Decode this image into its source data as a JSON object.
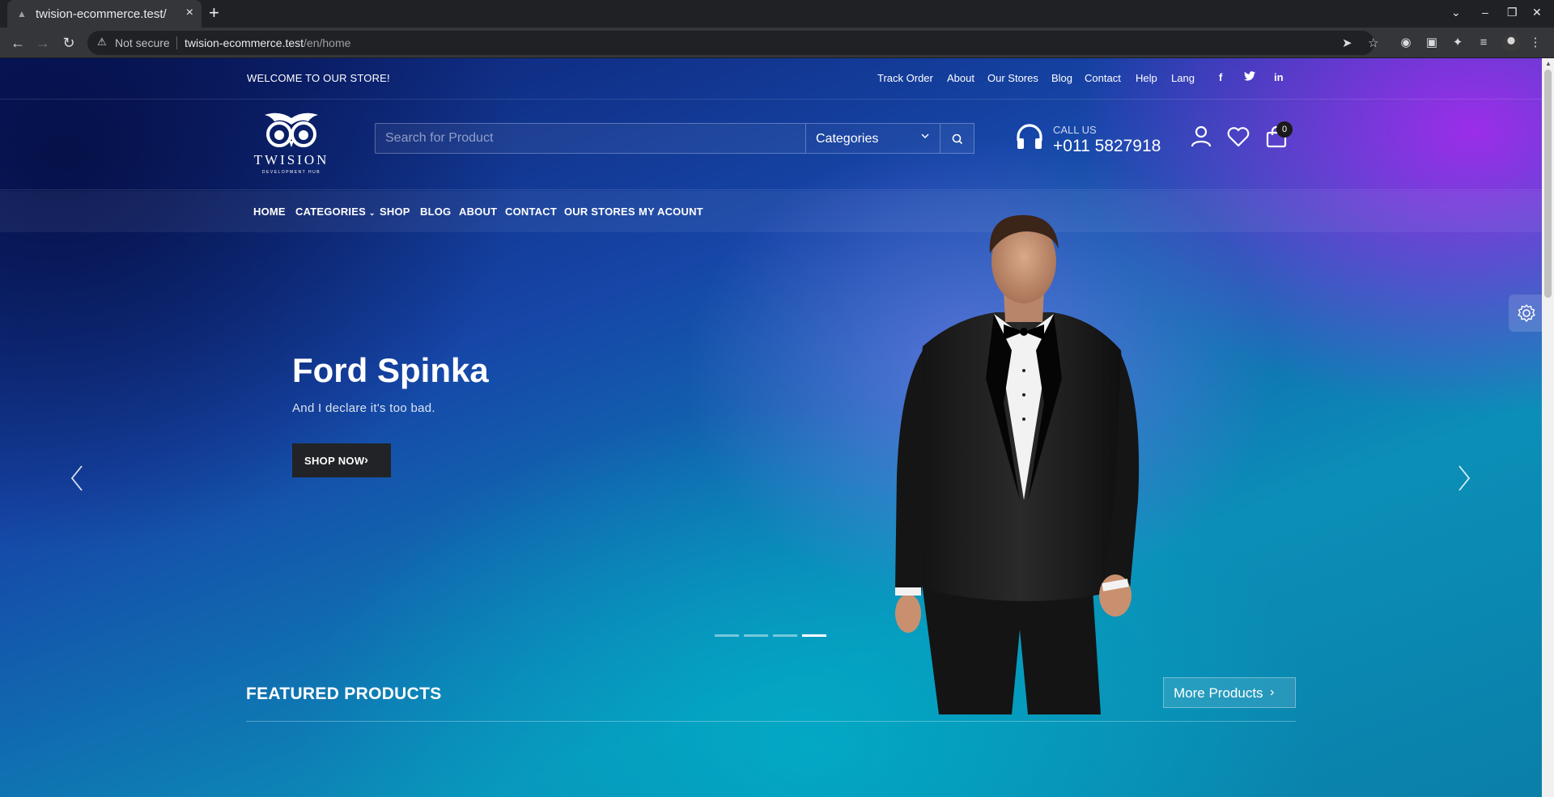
{
  "browser": {
    "tab_title": "twision-ecommerce.test/",
    "security_label": "Not secure",
    "url_domain": "twision-ecommerce.test",
    "url_path": "/en/home"
  },
  "topbar": {
    "welcome": "WELCOME TO OUR STORE!",
    "links": [
      "Track Order",
      "About",
      "Our Stores",
      "Blog",
      "Contact",
      "Help",
      "Lang"
    ],
    "social": [
      "facebook-icon",
      "twitter-icon",
      "linkedin-icon"
    ]
  },
  "logo": {
    "title": "TWISION",
    "subtitle": "DEVELOPMENT HUB"
  },
  "search": {
    "placeholder": "Search for Product",
    "category_label": "Categories"
  },
  "contact": {
    "label": "CALL US",
    "phone": "+011 5827918"
  },
  "cart": {
    "count": "0"
  },
  "nav": {
    "items": [
      "HOME",
      "CATEGORIES",
      "SHOP",
      "BLOG",
      "ABOUT",
      "CONTACT",
      "OUR STORES",
      "MY ACOUNT"
    ]
  },
  "hero": {
    "title": "Ford Spinka",
    "subtitle": "And I declare it's too bad.",
    "cta": "SHOP NOW",
    "slide_count": 4,
    "active_slide": 4
  },
  "featured": {
    "title": "FEATURED PRODUCTS",
    "more_label": "More Products"
  },
  "colors": {
    "accent_purple": "#9b2ff0",
    "accent_blue": "#1646a8",
    "accent_teal": "#0b8fb8",
    "button_dark": "#222326"
  }
}
